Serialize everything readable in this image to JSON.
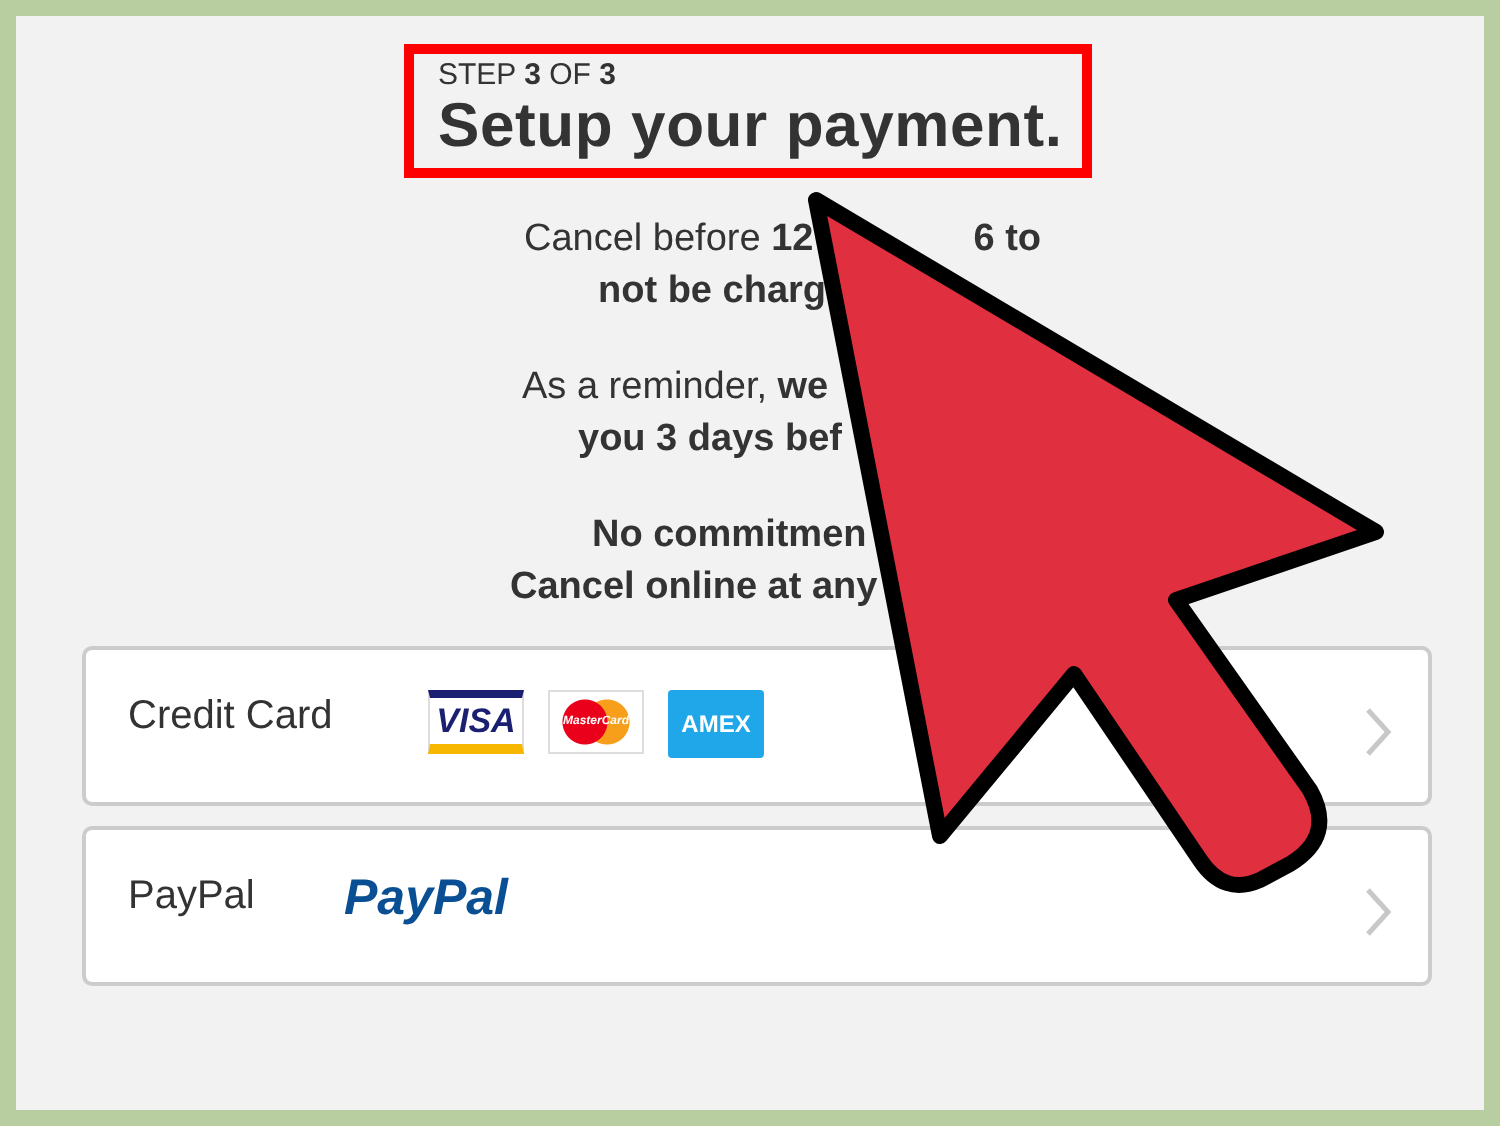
{
  "header": {
    "step": "STEP **3** OF **3**",
    "title": "Setup your payment.",
    "highlighted": true
  },
  "notice_paragraphs": [
    {
      "lines": [
        {
          "left": "Cancel before **12**",
          "right": "6 to",
          "bold": false
        },
        {
          "left": "not be charg",
          "bold": true
        }
      ]
    },
    {
      "lines": [
        {
          "left": "As a reminder, **we**",
          "bold": false
        },
        {
          "left": "you 3 days bef",
          "bold": true
        }
      ]
    },
    {
      "lines": [
        {
          "left": "No commitmen",
          "bold": true
        },
        {
          "left": "Cancel online at any",
          "bold": true
        }
      ]
    }
  ],
  "payment_options": [
    {
      "kind": "cards",
      "label": "Credit Card",
      "logos": [
        {
          "kind": "visa",
          "text": "VISA"
        },
        {
          "kind": "mastercard",
          "text": "MasterCard"
        },
        {
          "kind": "amex",
          "text": "AMEX"
        }
      ]
    },
    {
      "kind": "paypal",
      "label": "PayPal",
      "logos": [
        {
          "kind": "paypal",
          "text": "PayPal"
        }
      ]
    }
  ],
  "overlay": {
    "arrow": true
  }
}
